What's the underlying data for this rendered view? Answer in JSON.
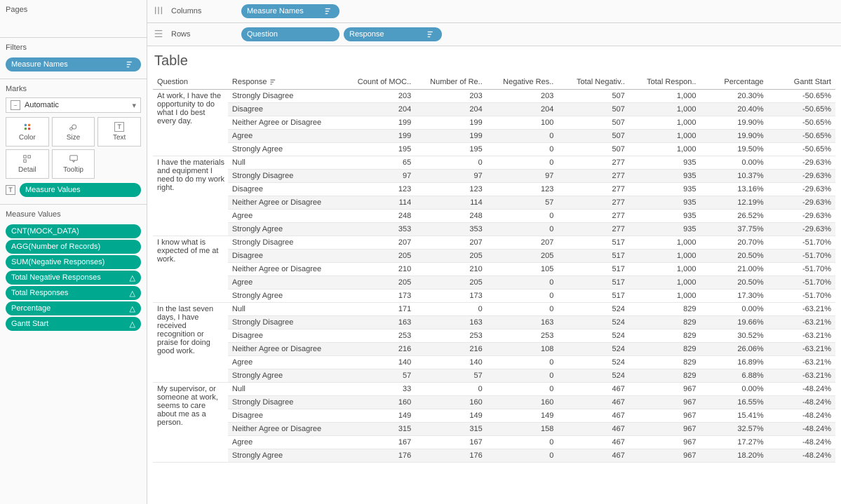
{
  "sidebar": {
    "pages_title": "Pages",
    "filters_title": "Filters",
    "filters_pill": "Measure Names",
    "marks_title": "Marks",
    "marks_type": "Automatic",
    "mark_btns": [
      "Color",
      "Size",
      "Text",
      "Detail",
      "Tooltip"
    ],
    "measure_values_pill": "Measure Values",
    "mv_title": "Measure Values",
    "mv_pills": [
      {
        "label": "CNT(MOCK_DATA)",
        "delta": false
      },
      {
        "label": "AGG(Number of Records)",
        "delta": false
      },
      {
        "label": "SUM(Negative Responses)",
        "delta": false
      },
      {
        "label": "Total Negative Responses",
        "delta": true
      },
      {
        "label": "Total Responses",
        "delta": true
      },
      {
        "label": "Percentage",
        "delta": true
      },
      {
        "label": "Gantt Start",
        "delta": true
      }
    ]
  },
  "shelves": {
    "columns_label": "Columns",
    "rows_label": "Rows",
    "columns_pills": [
      "Measure Names"
    ],
    "rows_pills": [
      "Question",
      "Response"
    ]
  },
  "table": {
    "title": "Table",
    "headers": [
      "Question",
      "Response",
      "Count of MOC..",
      "Number of Re..",
      "Negative Res..",
      "Total Negativ..",
      "Total Respon..",
      "Percentage",
      "Gantt Start"
    ],
    "groups": [
      {
        "question": "At work, I have the opportunity to do what I do best every day.",
        "rows": [
          {
            "resp": "Strongly Disagree",
            "v": [
              "203",
              "203",
              "203",
              "507",
              "1,000",
              "20.30%",
              "-50.65%"
            ]
          },
          {
            "resp": "Disagree",
            "v": [
              "204",
              "204",
              "204",
              "507",
              "1,000",
              "20.40%",
              "-50.65%"
            ]
          },
          {
            "resp": "Neither Agree or Disagree",
            "v": [
              "199",
              "199",
              "100",
              "507",
              "1,000",
              "19.90%",
              "-50.65%"
            ]
          },
          {
            "resp": "Agree",
            "v": [
              "199",
              "199",
              "0",
              "507",
              "1,000",
              "19.90%",
              "-50.65%"
            ]
          },
          {
            "resp": "Strongly Agree",
            "v": [
              "195",
              "195",
              "0",
              "507",
              "1,000",
              "19.50%",
              "-50.65%"
            ]
          }
        ]
      },
      {
        "question": "I have the materials and equipment I need to do my work right.",
        "rows": [
          {
            "resp": "Null",
            "v": [
              "65",
              "0",
              "0",
              "277",
              "935",
              "0.00%",
              "-29.63%"
            ]
          },
          {
            "resp": "Strongly Disagree",
            "v": [
              "97",
              "97",
              "97",
              "277",
              "935",
              "10.37%",
              "-29.63%"
            ]
          },
          {
            "resp": "Disagree",
            "v": [
              "123",
              "123",
              "123",
              "277",
              "935",
              "13.16%",
              "-29.63%"
            ]
          },
          {
            "resp": "Neither Agree or Disagree",
            "v": [
              "114",
              "114",
              "57",
              "277",
              "935",
              "12.19%",
              "-29.63%"
            ]
          },
          {
            "resp": "Agree",
            "v": [
              "248",
              "248",
              "0",
              "277",
              "935",
              "26.52%",
              "-29.63%"
            ]
          },
          {
            "resp": "Strongly Agree",
            "v": [
              "353",
              "353",
              "0",
              "277",
              "935",
              "37.75%",
              "-29.63%"
            ]
          }
        ]
      },
      {
        "question": "I know what is expected of me at work.",
        "rows": [
          {
            "resp": "Strongly Disagree",
            "v": [
              "207",
              "207",
              "207",
              "517",
              "1,000",
              "20.70%",
              "-51.70%"
            ]
          },
          {
            "resp": "Disagree",
            "v": [
              "205",
              "205",
              "205",
              "517",
              "1,000",
              "20.50%",
              "-51.70%"
            ]
          },
          {
            "resp": "Neither Agree or Disagree",
            "v": [
              "210",
              "210",
              "105",
              "517",
              "1,000",
              "21.00%",
              "-51.70%"
            ]
          },
          {
            "resp": "Agree",
            "v": [
              "205",
              "205",
              "0",
              "517",
              "1,000",
              "20.50%",
              "-51.70%"
            ]
          },
          {
            "resp": "Strongly Agree",
            "v": [
              "173",
              "173",
              "0",
              "517",
              "1,000",
              "17.30%",
              "-51.70%"
            ]
          }
        ]
      },
      {
        "question": "In the last seven days, I have received recognition or praise for doing good work.",
        "rows": [
          {
            "resp": "Null",
            "v": [
              "171",
              "0",
              "0",
              "524",
              "829",
              "0.00%",
              "-63.21%"
            ]
          },
          {
            "resp": "Strongly Disagree",
            "v": [
              "163",
              "163",
              "163",
              "524",
              "829",
              "19.66%",
              "-63.21%"
            ]
          },
          {
            "resp": "Disagree",
            "v": [
              "253",
              "253",
              "253",
              "524",
              "829",
              "30.52%",
              "-63.21%"
            ]
          },
          {
            "resp": "Neither Agree or Disagree",
            "v": [
              "216",
              "216",
              "108",
              "524",
              "829",
              "26.06%",
              "-63.21%"
            ]
          },
          {
            "resp": "Agree",
            "v": [
              "140",
              "140",
              "0",
              "524",
              "829",
              "16.89%",
              "-63.21%"
            ]
          },
          {
            "resp": "Strongly Agree",
            "v": [
              "57",
              "57",
              "0",
              "524",
              "829",
              "6.88%",
              "-63.21%"
            ]
          }
        ]
      },
      {
        "question": "My supervisor, or someone at work, seems to care about me as a person.",
        "rows": [
          {
            "resp": "Null",
            "v": [
              "33",
              "0",
              "0",
              "467",
              "967",
              "0.00%",
              "-48.24%"
            ]
          },
          {
            "resp": "Strongly Disagree",
            "v": [
              "160",
              "160",
              "160",
              "467",
              "967",
              "16.55%",
              "-48.24%"
            ]
          },
          {
            "resp": "Disagree",
            "v": [
              "149",
              "149",
              "149",
              "467",
              "967",
              "15.41%",
              "-48.24%"
            ]
          },
          {
            "resp": "Neither Agree or Disagree",
            "v": [
              "315",
              "315",
              "158",
              "467",
              "967",
              "32.57%",
              "-48.24%"
            ]
          },
          {
            "resp": "Agree",
            "v": [
              "167",
              "167",
              "0",
              "467",
              "967",
              "17.27%",
              "-48.24%"
            ]
          },
          {
            "resp": "Strongly Agree",
            "v": [
              "176",
              "176",
              "0",
              "467",
              "967",
              "18.20%",
              "-48.24%"
            ]
          }
        ]
      }
    ]
  }
}
